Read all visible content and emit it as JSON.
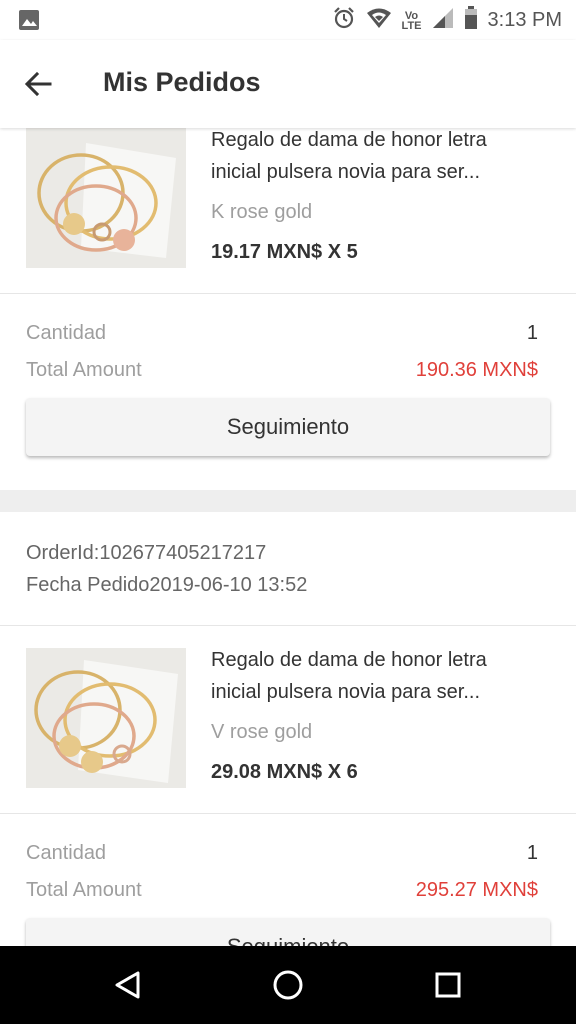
{
  "status_bar": {
    "time": "3:13 PM",
    "volte_top": "Vo",
    "volte_bottom": "LTE",
    "icons": [
      "image-icon",
      "alarm-icon",
      "wifi-icon",
      "volte-icon",
      "signal-icon",
      "battery-icon"
    ]
  },
  "app_bar": {
    "title": "Mis Pedidos",
    "back_icon": "arrow-back-icon"
  },
  "orders": [
    {
      "product": {
        "title_line1": "Regalo de dama de honor letra",
        "title_line2": "inicial pulsera novia para ser...",
        "variant": "K rose gold",
        "price": "19.17 MXN$ X 5"
      },
      "summary": {
        "quantity_label": "Cantidad",
        "quantity_value": "1",
        "total_label": "Total Amount",
        "total_value": "190.36 MXN$",
        "button_label": "Seguimiento"
      }
    },
    {
      "order_id": "OrderId:102677405217217",
      "order_date": "Fecha Pedido2019-06-10 13:52",
      "product": {
        "title_line1": "Regalo de dama de honor letra",
        "title_line2": "inicial pulsera novia para ser...",
        "variant": "V rose gold",
        "price": "29.08 MXN$ X 6"
      },
      "summary": {
        "quantity_label": "Cantidad",
        "quantity_value": "1",
        "total_label": "Total Amount",
        "total_value": "295.27 MXN$",
        "button_label": "Seguimiento"
      }
    }
  ],
  "colors": {
    "accent_red": "#e0403a",
    "background": "#eeeeee",
    "nav_bar": "#000000"
  },
  "nav_bar": {
    "icons": [
      "back-triangle-icon",
      "home-circle-icon",
      "recents-square-icon"
    ]
  }
}
